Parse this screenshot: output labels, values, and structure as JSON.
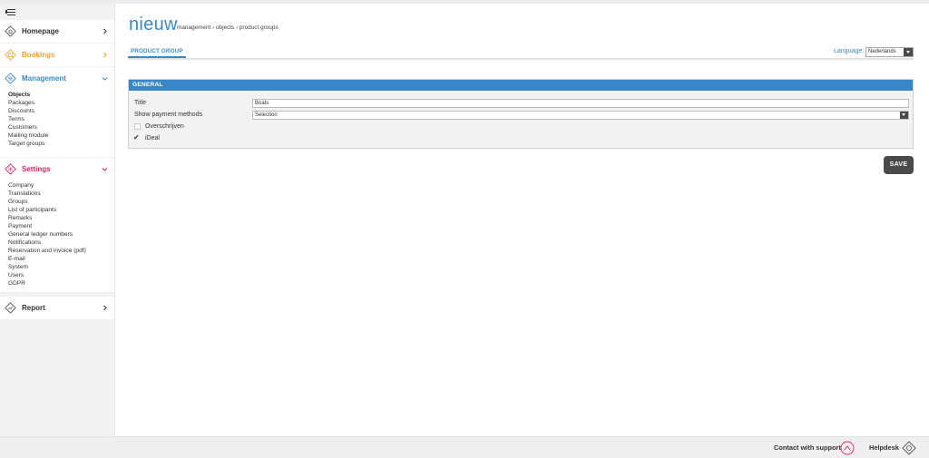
{
  "sidebar": {
    "homepage": {
      "label": "Homepage",
      "color": "#333333"
    },
    "bookings": {
      "label": "Bookings",
      "color": "#f0a030"
    },
    "management": {
      "label": "Management",
      "color": "#3a8ac4",
      "items": [
        "Objects",
        "Packages",
        "Discounts",
        "Terms",
        "Customers",
        "Mailing module",
        "Target groups"
      ]
    },
    "settings": {
      "label": "Settings",
      "color": "#e0245e",
      "items": [
        "Company",
        "Translations",
        "Groups",
        "List of participants",
        "Remarks",
        "Payment",
        "General ledger numbers",
        "Notifications",
        "Reservation and invoice (pdf)",
        "E-mail",
        "System",
        "Users",
        "GDPR"
      ]
    },
    "report": {
      "label": "Report",
      "color": "#333333"
    }
  },
  "header": {
    "title": "nieuw",
    "breadcrumb": "management › objects › product groups"
  },
  "tabs": {
    "product_group": "PRODUCT GROUP"
  },
  "language": {
    "label": "Language:",
    "value": "Nederlands"
  },
  "panel": {
    "title": "GENERAL",
    "title_label": "Title",
    "title_value": "Boats",
    "payment_label": "Show payment methods",
    "payment_value": "Selection",
    "methods": [
      {
        "label": "Overschrijven",
        "checked": false
      },
      {
        "label": "iDeal",
        "checked": true,
        "mark": "✔"
      }
    ]
  },
  "actions": {
    "save": "SAVE"
  },
  "footer": {
    "support": "Contact with support",
    "helpdesk": "Helpdesk"
  },
  "colors": {
    "accent": "#3a8ac4",
    "panel_header": "#3a85c6",
    "button": "#4a4a4a",
    "support_icon": "#e0245e"
  }
}
